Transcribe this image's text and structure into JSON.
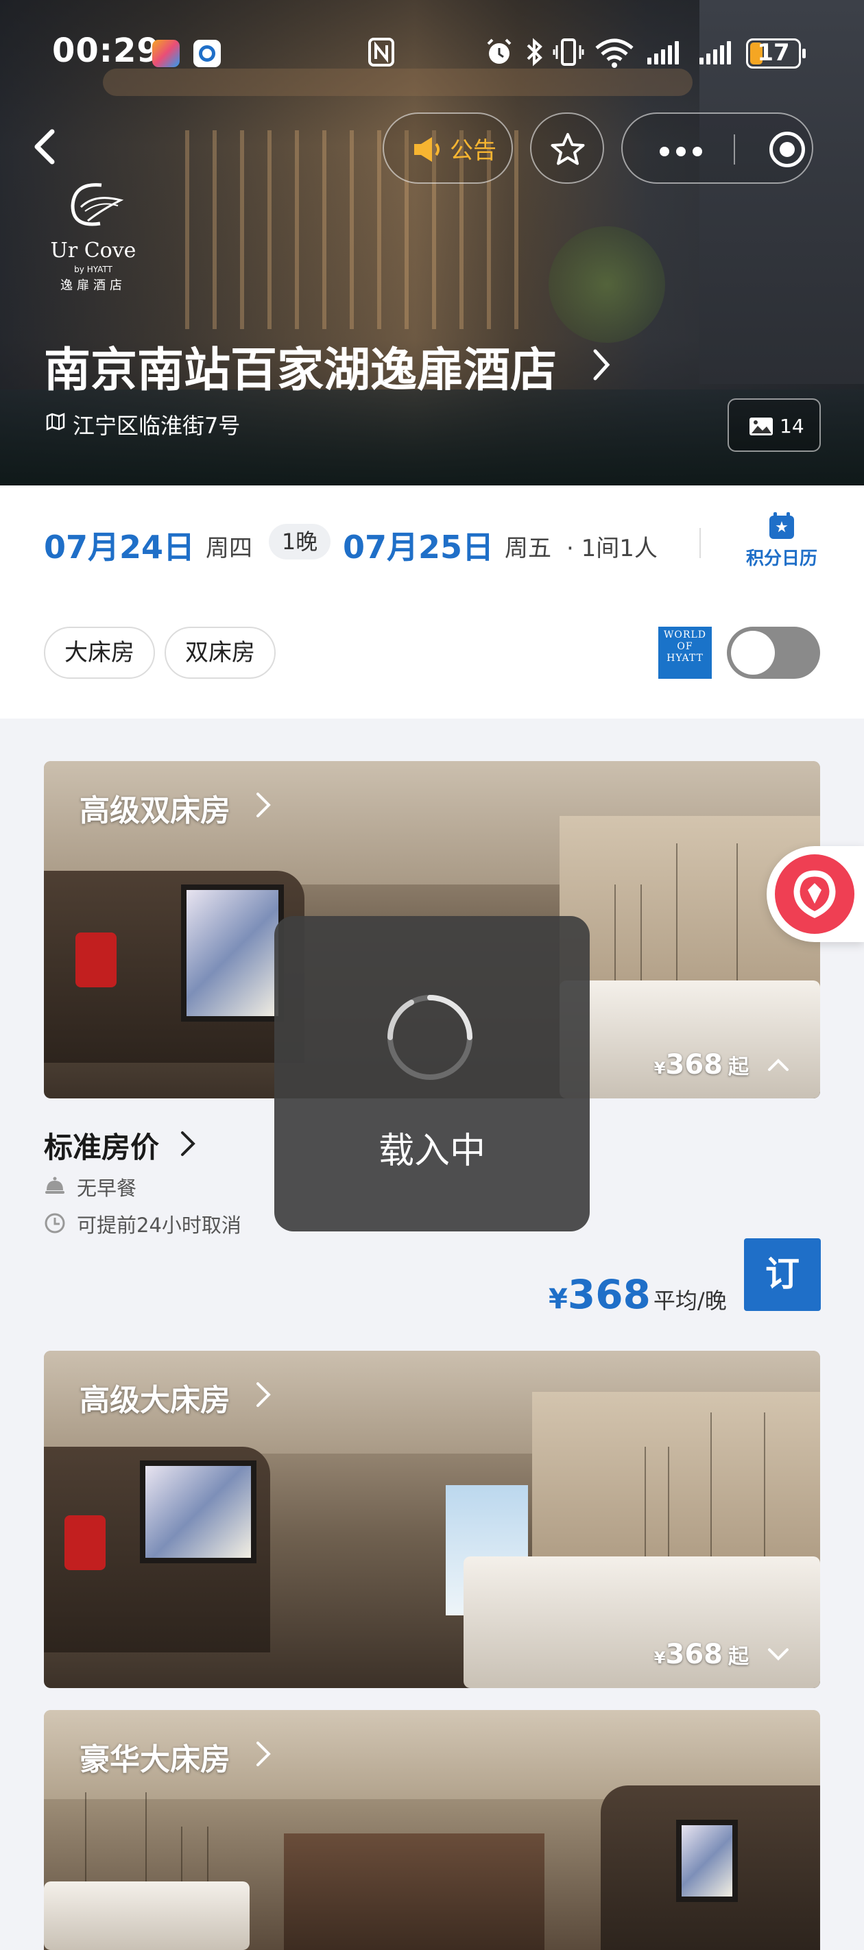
{
  "status_bar": {
    "time": "00:29",
    "battery": "17"
  },
  "hero": {
    "notice_label": "公告",
    "logo": {
      "brand": "Ur Cove",
      "by": "by HYATT",
      "cn": "逸扉酒店"
    },
    "hotel_name": "南京南站百家湖逸扉酒店",
    "address": "江宁区临淮街7号",
    "photo_count": "14"
  },
  "booking": {
    "checkin_date": "07月24日",
    "checkin_weekday": "周四",
    "nights": "1晚",
    "checkout_date": "07月25日",
    "checkout_weekday": "周五",
    "rooms_guests": "· 1间1人",
    "calendar_label": "积分日历",
    "filters": [
      "大床房",
      "双床房"
    ],
    "world_of_hyatt": "WORLD OF HYATT",
    "world_lines": [
      "WORLD",
      "OF",
      "HYATT"
    ]
  },
  "rooms": [
    {
      "name": "高级双床房",
      "price_currency": "¥",
      "price": "368",
      "price_suffix": "起",
      "expanded": true
    },
    {
      "name": "高级大床房",
      "price_currency": "¥",
      "price": "368",
      "price_suffix": "起",
      "expanded": false
    },
    {
      "name": "豪华大床房"
    }
  ],
  "rate": {
    "title": "标准房价",
    "breakfast": "无早餐",
    "cancel_policy": "可提前24小时取消",
    "currency": "¥",
    "price": "368",
    "per_night": "平均/晚",
    "book_label": "订"
  },
  "loading": {
    "label": "载入中"
  },
  "colors": {
    "accent": "#1f6fc8",
    "notice": "#f7b531",
    "badge": "#ef3f53",
    "coffee_machine": "#c21f1f"
  }
}
